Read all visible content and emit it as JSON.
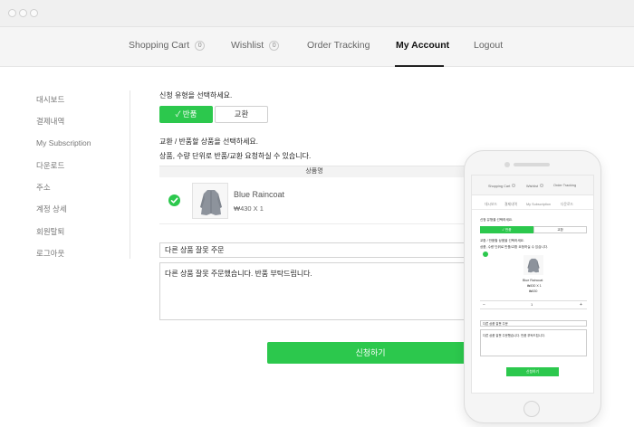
{
  "nav": {
    "items": [
      {
        "label": "Shopping Cart",
        "badge": "0"
      },
      {
        "label": "Wishlist",
        "badge": "0"
      },
      {
        "label": "Order Tracking"
      },
      {
        "label": "My Account",
        "active": true
      },
      {
        "label": "Logout"
      }
    ]
  },
  "sidebar": {
    "items": [
      "대시보드",
      "결제내역",
      "My Subscription",
      "다운로드",
      "주소",
      "계정 상세",
      "회원탈퇴",
      "로그아웃"
    ]
  },
  "form": {
    "type_prompt": "신청 유형을 선택하세요.",
    "return_label": "반품",
    "exchange_label": "교환",
    "select_prompt": "교환 / 반품할 상품을 선택하세요.",
    "note": "상품, 수량 단위로 반품/교환 요청하실 수 있습니다.",
    "table_header": "상품명",
    "product": {
      "name": "Blue Raincoat",
      "price": "₩430 X 1"
    },
    "reason_selected": "다른 상품 잘못 주문",
    "message": "다른 상품 잘못 주문했습니다. 반품 부탁드립니다.",
    "submit_label": "신청하기"
  },
  "mobile": {
    "nav": [
      {
        "label": "Shopping Cart",
        "badge": "0"
      },
      {
        "label": "Wishlist",
        "badge": "0"
      },
      {
        "label": "Order Tracking"
      }
    ],
    "tabs": [
      "대시보드",
      "결제내역",
      "My Subscription",
      "다운로드"
    ],
    "type_prompt": "신청 유형을 선택하세요.",
    "return_label": "반품",
    "exchange_label": "교환",
    "select_prompt": "교환 / 반품할 상품을 선택하세요.",
    "note": "상품, 수량 단위로 반품/교환 요청하실 수 있습니다.",
    "product_name": "Blue Raincoat",
    "product_qty": "₩430 X 1",
    "product_price": "₩430",
    "stepper_minus": "−",
    "stepper_value": "1",
    "stepper_plus": "+",
    "reason_selected": "다른 상품 잘못 주문",
    "message": "다른 상품 잘못 주문했습니다. 반품 부탁드립니다.",
    "submit_label": "신청하기"
  },
  "colors": {
    "accent": "#2cc84d",
    "nav_bg": "#f5f5f5"
  }
}
